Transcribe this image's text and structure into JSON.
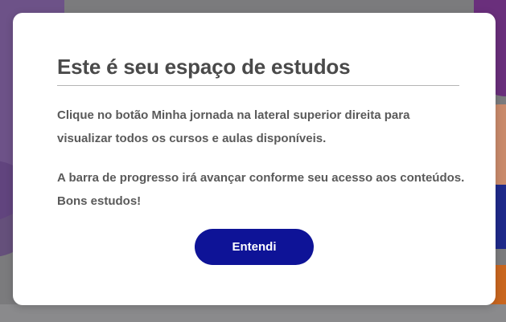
{
  "modal": {
    "title": "Este é seu espaço de estudos",
    "paragraph_1": "Clique no botão Minha jornada na lateral superior direita para visualizar todos os cursos e aulas disponíveis.",
    "paragraph_2": "A barra de progresso irá avançar conforme seu acesso aos conteúdos. Bons estudos!",
    "confirm_button": "Entendi"
  },
  "colors": {
    "button_bg": "#0e1397",
    "overlay": "#7b7b7d",
    "title_text": "#4a4a4a",
    "body_text": "#5a5a5a"
  }
}
